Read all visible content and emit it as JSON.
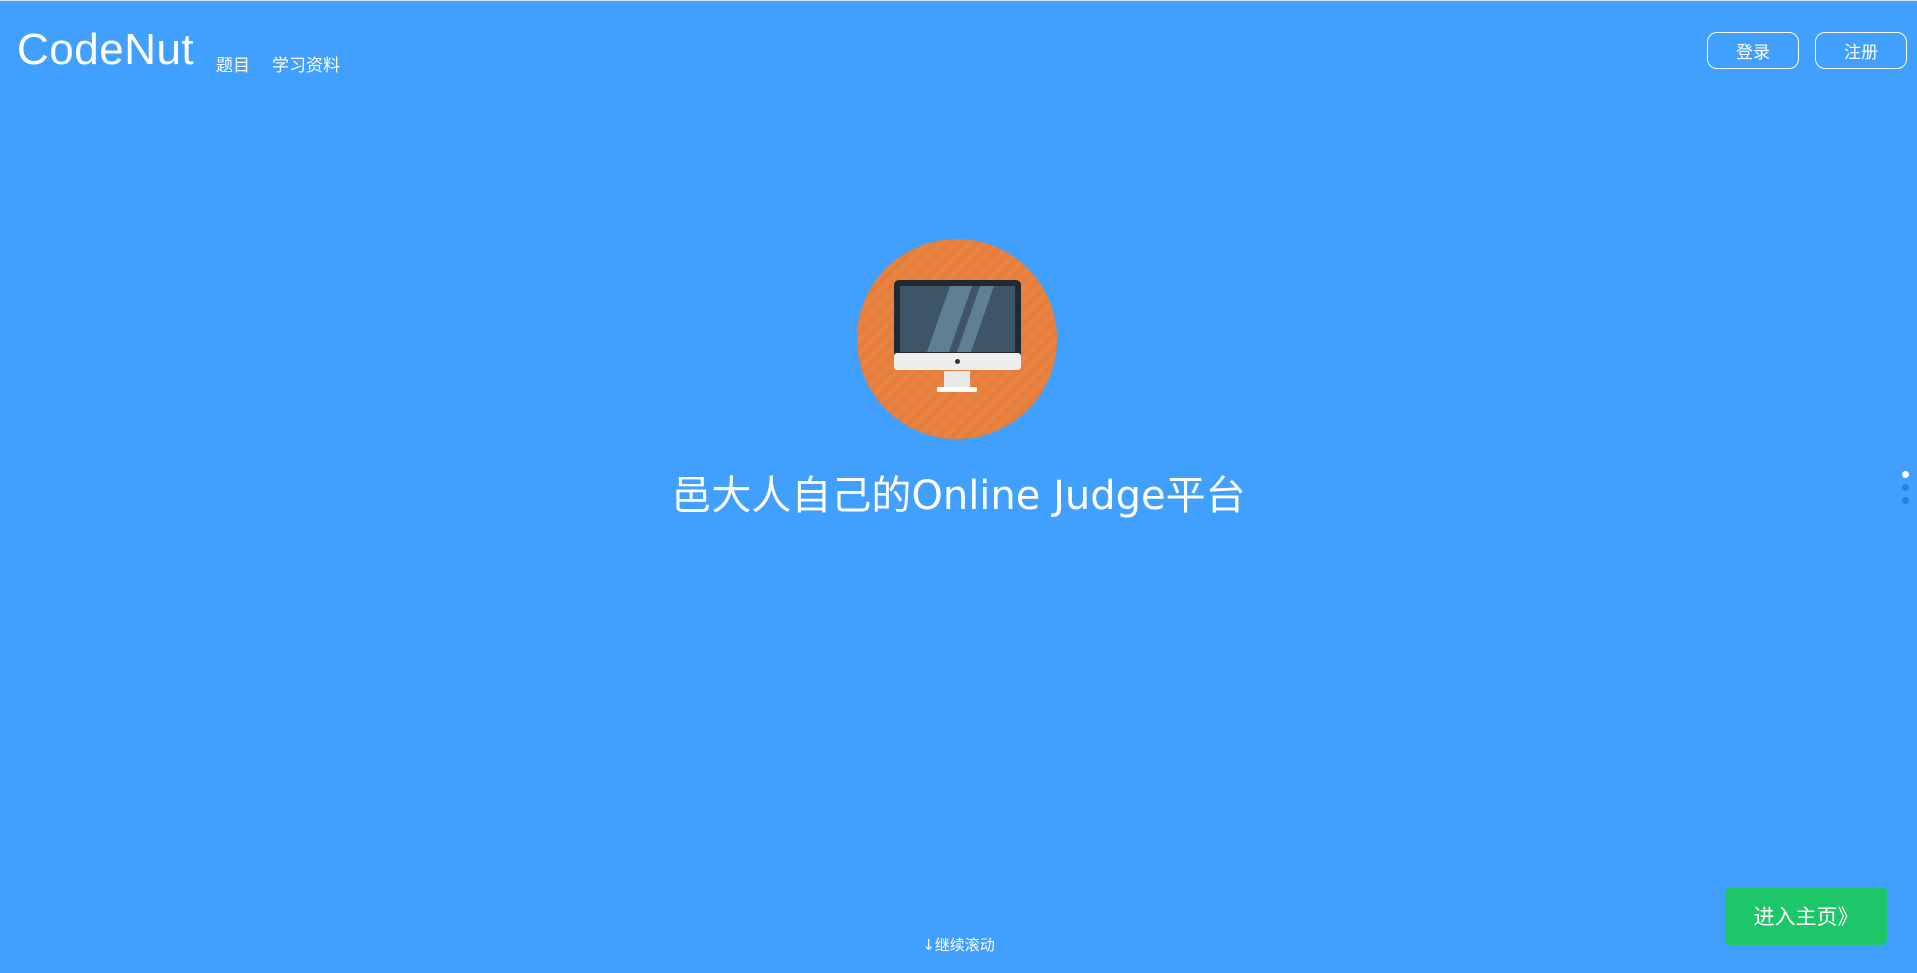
{
  "header": {
    "brand": "CodeNut",
    "nav": [
      {
        "label": "题目"
      },
      {
        "label": "学习资料"
      }
    ],
    "login_label": "登录",
    "register_label": "注册"
  },
  "hero": {
    "title": "邑大人自己的Online Judge平台",
    "icon": "desktop-computer-icon"
  },
  "section_dots": {
    "count": 3,
    "active_index": 0
  },
  "scroll_hint": "↓继续滚动",
  "enter_button": "进入主页》",
  "colors": {
    "background": "#419ffe",
    "icon_circle": "#e67e3b",
    "enter_button": "#1ec66a",
    "text": "#ffffff"
  }
}
